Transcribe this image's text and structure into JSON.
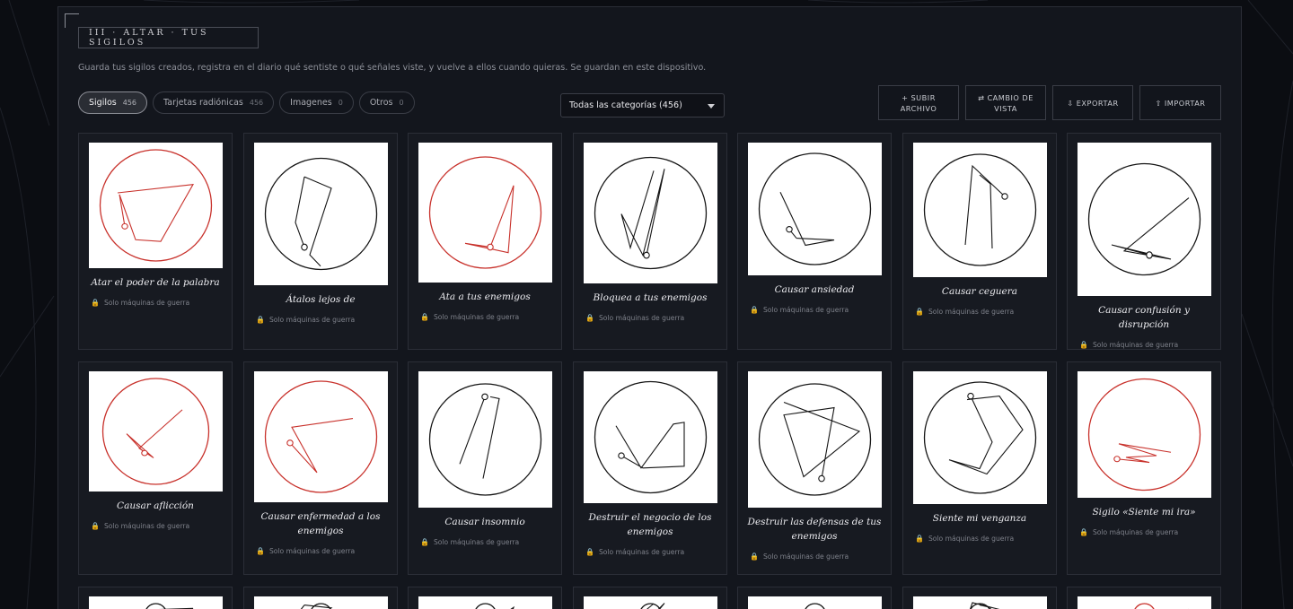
{
  "header": {
    "title": "III · ALTAR · TUS SIGILOS",
    "subtitle": "Guarda tus sigilos creados, registra en el diario qué sentiste o qué señales viste, y vuelve a ellos cuando quieras. Se guardan en este dispositivo."
  },
  "filters": [
    {
      "label": "Sigilos",
      "count": "456",
      "active": true
    },
    {
      "label": "Tarjetas radiónicas",
      "count": "456",
      "active": false
    },
    {
      "label": "Imagenes",
      "count": "0",
      "active": false
    },
    {
      "label": "Otros",
      "count": "0",
      "active": false
    }
  ],
  "category_select": {
    "value": "Todas las categorías (456)"
  },
  "actions": [
    {
      "icon": "+",
      "label": "SUBIR ARCHIVO",
      "icon_name": "plus-icon"
    },
    {
      "icon": "⇄",
      "label": "CAMBIO DE VISTA",
      "icon_name": "swap-icon"
    },
    {
      "icon": "⇩",
      "label": "EXPORTAR",
      "icon_name": "download-icon"
    },
    {
      "icon": "⇧",
      "label": "IMPORTAR",
      "icon_name": "upload-icon"
    }
  ],
  "lock_icon": "lock-icon",
  "colors": {
    "red_sigil": "#c8312b",
    "black_sigil": "#151515",
    "lock": "#c9962e"
  },
  "cards": [
    {
      "name": "Atar el poder de la palabra",
      "badge": "Solo máquinas de guerra",
      "color": "red"
    },
    {
      "name": "Átalos lejos de",
      "badge": "Solo máquinas de guerra",
      "color": "black"
    },
    {
      "name": "Ata a tus enemigos",
      "badge": "Solo máquinas de guerra",
      "color": "red"
    },
    {
      "name": "Bloquea a tus enemigos",
      "badge": "Solo máquinas de guerra",
      "color": "black"
    },
    {
      "name": "Causar ansiedad",
      "badge": "Solo máquinas de guerra",
      "color": "black"
    },
    {
      "name": "Causar ceguera",
      "badge": "Solo máquinas de guerra",
      "color": "black"
    },
    {
      "name": "Causar confusión y disrupción",
      "badge": "Solo máquinas de guerra",
      "color": "black"
    },
    {
      "name": "Causar aflicción",
      "badge": "Solo máquinas de guerra",
      "color": "red"
    },
    {
      "name": "Causar enfermedad a los enemigos",
      "badge": "Solo máquinas de guerra",
      "color": "red"
    },
    {
      "name": "Causar insomnio",
      "badge": "Solo máquinas de guerra",
      "color": "black"
    },
    {
      "name": "Destruir el negocio de los enemigos",
      "badge": "Solo máquinas de guerra",
      "color": "black"
    },
    {
      "name": "Destruir las defensas de tus enemigos",
      "badge": "Solo máquinas de guerra",
      "color": "black"
    },
    {
      "name": "Siente mi venganza",
      "badge": "Solo máquinas de guerra",
      "color": "black"
    },
    {
      "name": "Sigilo «Siente mi ira»",
      "badge": "Solo máquinas de guerra",
      "color": "red"
    },
    {
      "name": "",
      "badge": "",
      "color": "black"
    },
    {
      "name": "",
      "badge": "",
      "color": "black"
    },
    {
      "name": "",
      "badge": "",
      "color": "black"
    },
    {
      "name": "",
      "badge": "",
      "color": "black"
    },
    {
      "name": "",
      "badge": "",
      "color": "black"
    },
    {
      "name": "",
      "badge": "",
      "color": "black"
    },
    {
      "name": "",
      "badge": "",
      "color": "red"
    }
  ]
}
